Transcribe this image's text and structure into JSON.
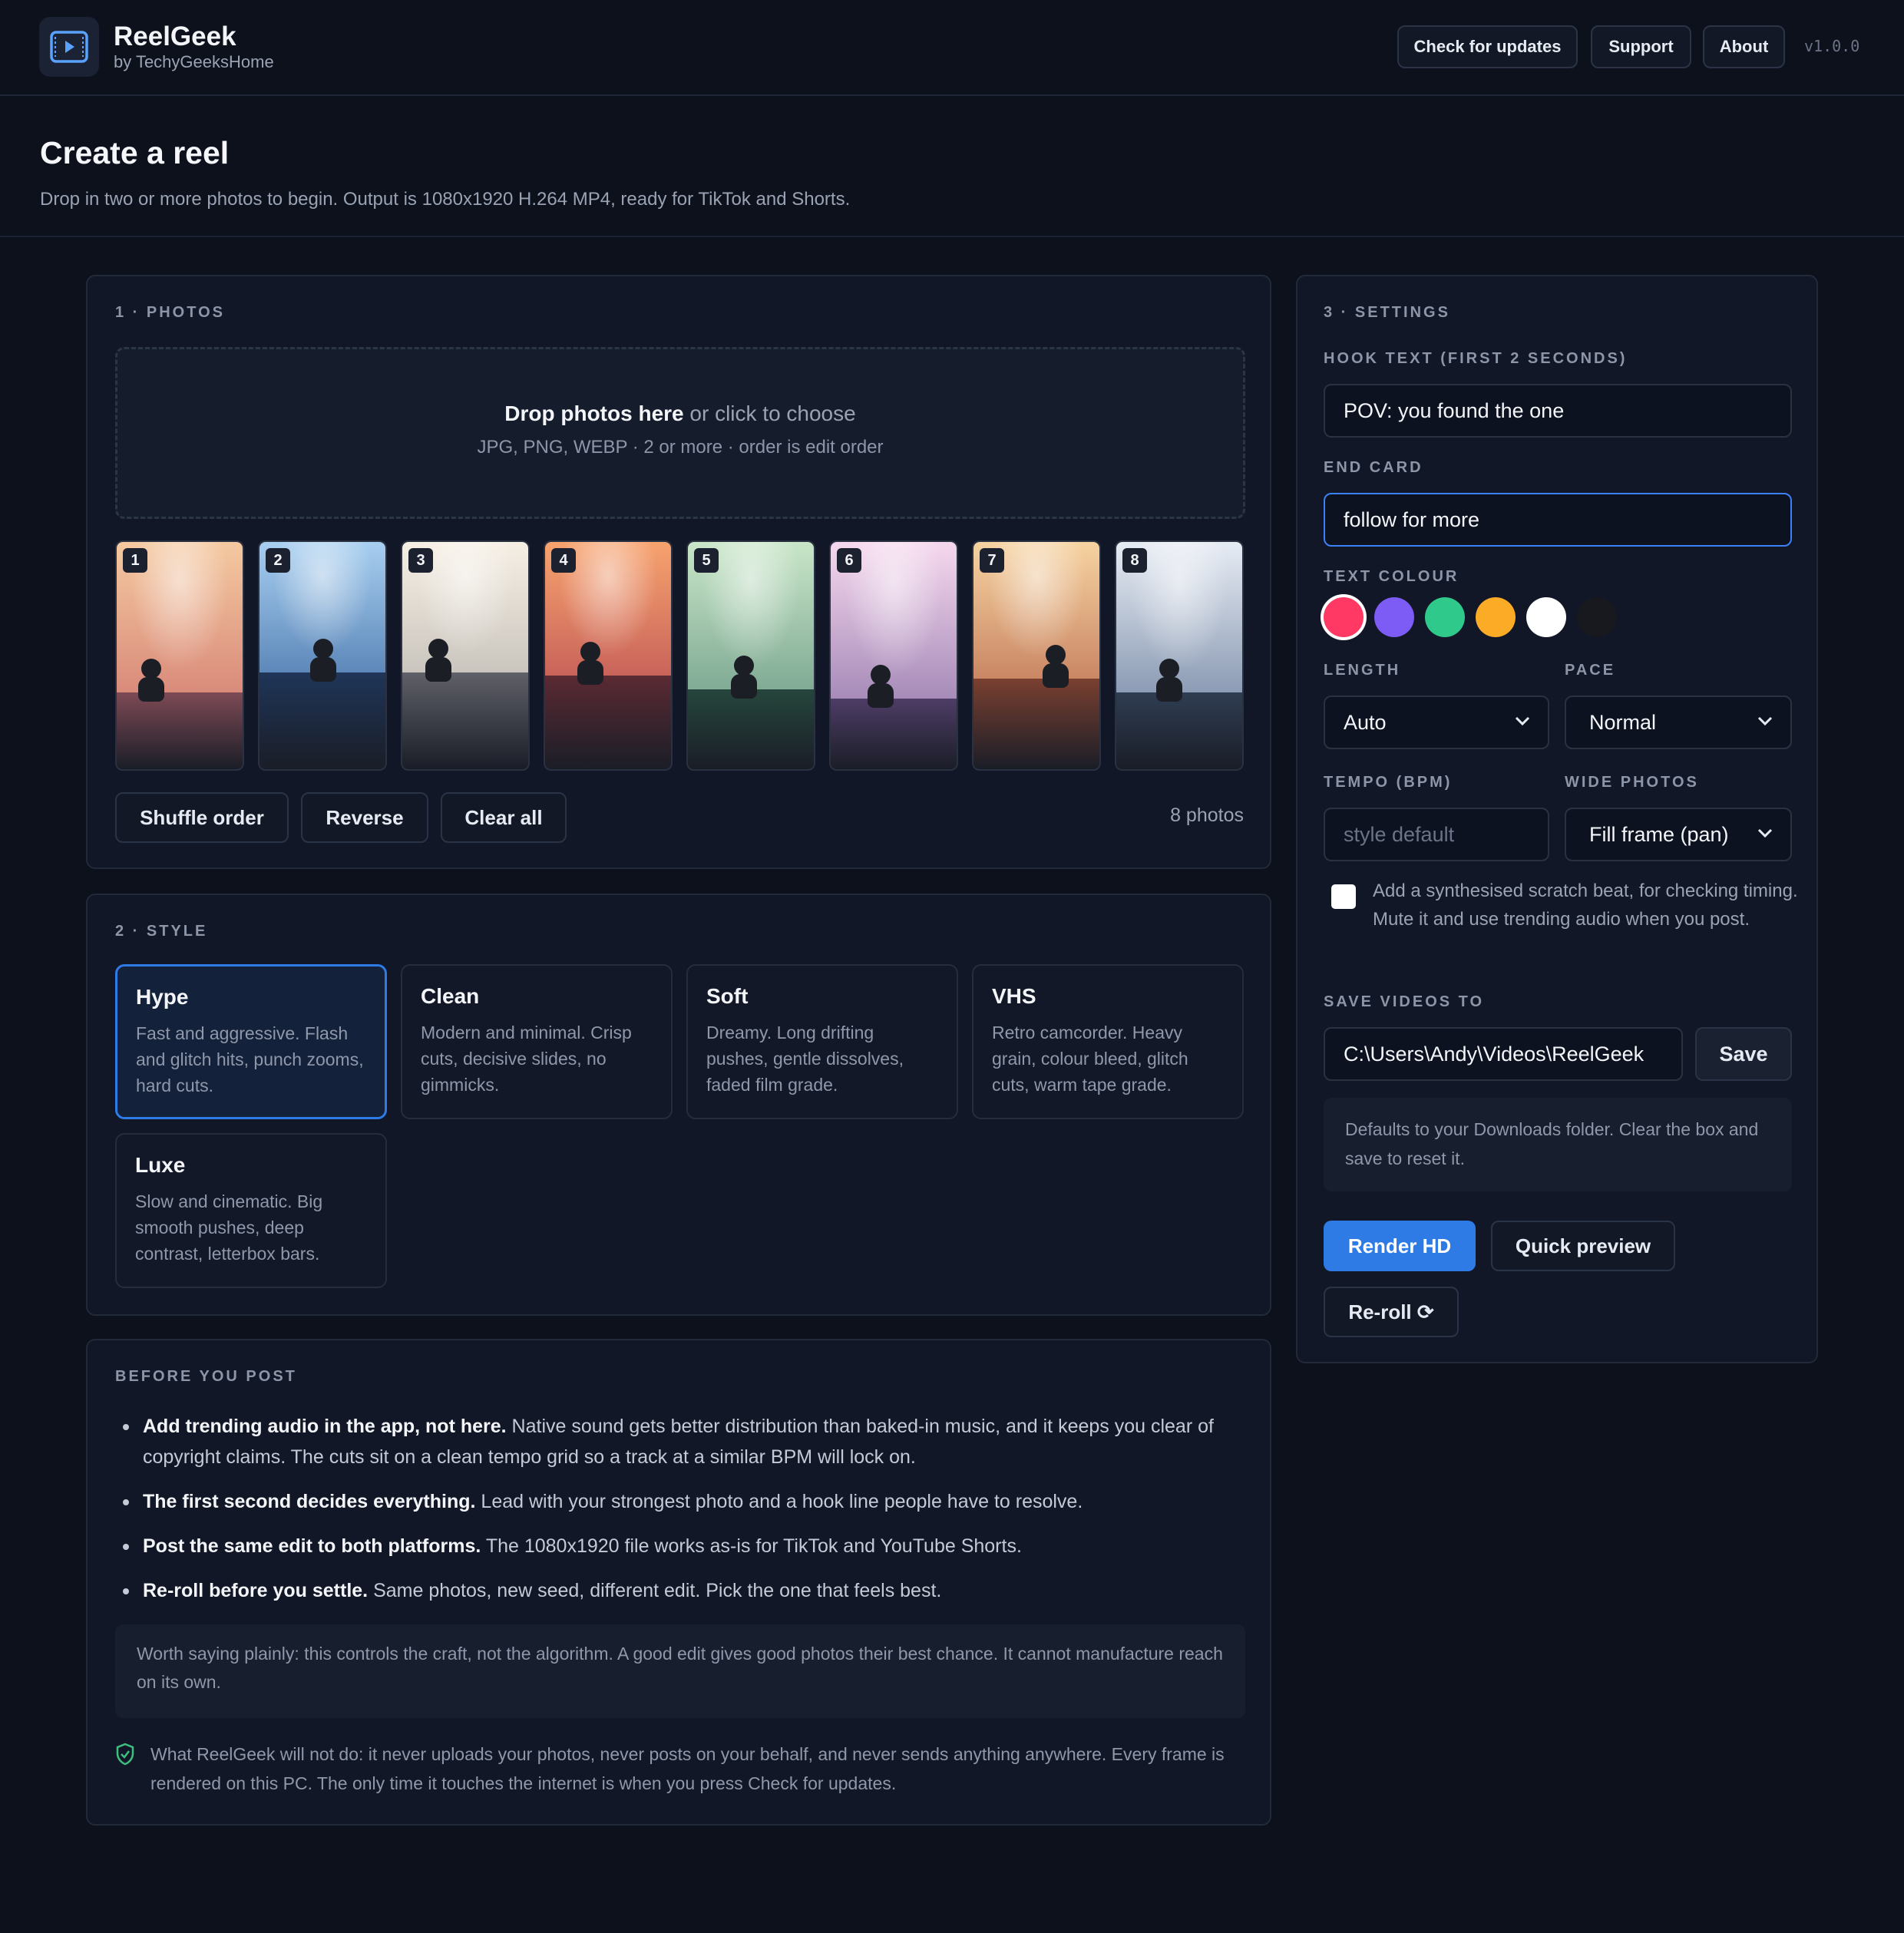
{
  "app": {
    "name": "ReelGeek",
    "byline": "by TechyGeeksHome",
    "version": "v1.0.0",
    "buttons": {
      "check_updates": "Check for updates",
      "support": "Support",
      "about": "About"
    }
  },
  "page": {
    "title": "Create a reel",
    "subtitle": "Drop in two or more photos to begin. Output is 1080x1920 H.264 MP4, ready for TikTok and Shorts."
  },
  "photos": {
    "section_label": "1 · PHOTOS",
    "drop_strong": "Drop photos here",
    "drop_rest": " or click to choose",
    "drop_hint": "JPG, PNG, WEBP · 2 or more · order is edit order",
    "items": [
      {
        "num": "1",
        "sky_top": "#f4c9a0",
        "sky_bottom": "#d98a7a",
        "ground": "#7d4a55"
      },
      {
        "num": "2",
        "sky_top": "#a8cff0",
        "sky_bottom": "#5b86b8",
        "ground": "#1f3558"
      },
      {
        "num": "3",
        "sky_top": "#f6efe4",
        "sky_bottom": "#c9c4bd",
        "ground": "#5f6068"
      },
      {
        "num": "4",
        "sky_top": "#f7a36e",
        "sky_bottom": "#c8625a",
        "ground": "#5b2a33"
      },
      {
        "num": "5",
        "sky_top": "#c9e6c8",
        "sky_bottom": "#7faa94",
        "ground": "#25463c"
      },
      {
        "num": "6",
        "sky_top": "#f6d8ee",
        "sky_bottom": "#a58ab8",
        "ground": "#4e3d66"
      },
      {
        "num": "7",
        "sky_top": "#f6d3a1",
        "sky_bottom": "#c98563",
        "ground": "#7a4030"
      },
      {
        "num": "8",
        "sky_top": "#e7ecf4",
        "sky_bottom": "#8a9ab3",
        "ground": "#2f3d52"
      }
    ],
    "shuffle_label": "Shuffle order",
    "reverse_label": "Reverse",
    "clear_label": "Clear all",
    "count": "8 photos"
  },
  "style": {
    "section_label": "2 · STYLE",
    "selected": "Hype",
    "cards": [
      {
        "name": "Hype",
        "desc": "Fast and aggressive. Flash and glitch hits, punch zooms, hard cuts."
      },
      {
        "name": "Clean",
        "desc": "Modern and minimal. Crisp cuts, decisive slides, no gimmicks."
      },
      {
        "name": "Soft",
        "desc": "Dreamy. Long drifting pushes, gentle dissolves, faded film grade."
      },
      {
        "name": "VHS",
        "desc": "Retro camcorder. Heavy grain, colour bleed, glitch cuts, warm tape grade."
      },
      {
        "name": "Luxe",
        "desc": "Slow and cinematic. Big smooth pushes, deep contrast, letterbox bars."
      }
    ]
  },
  "tips": {
    "section_label": "BEFORE YOU POST",
    "items": [
      {
        "bold": "Add trending audio in the app, not here.",
        "text": " Native sound gets better distribution than baked-in music, and it keeps you clear of copyright claims. The cuts sit on a clean tempo grid so a track at a similar BPM will lock on."
      },
      {
        "bold": "The first second decides everything.",
        "text": " Lead with your strongest photo and a hook line people have to resolve."
      },
      {
        "bold": "Post the same edit to both platforms.",
        "text": " The 1080x1920 file works as-is for TikTok and YouTube Shorts."
      },
      {
        "bold": "Re-roll before you settle.",
        "text": " Same photos, new seed, different edit. Pick the one that feels best."
      }
    ],
    "note": "Worth saying plainly: this controls the craft, not the algorithm. A good edit gives good photos their best chance. It cannot manufacture reach on its own.",
    "privacy": "What ReelGeek will not do: it never uploads your photos, never posts on your behalf, and never sends anything anywhere. Every frame is rendered on this PC. The only time it touches the internet is when you press Check for updates."
  },
  "settings": {
    "section_label": "3 · SETTINGS",
    "hook_label": "HOOK TEXT (FIRST 2 SECONDS)",
    "hook_value": "POV: you found the one",
    "end_card_label": "END CARD",
    "end_card_value": "follow for more",
    "text_colour_label": "TEXT COLOUR",
    "colours": [
      "#ff3864",
      "#7c5cf5",
      "#2fc98b",
      "#fbab26",
      "#ffffff",
      "#17191e"
    ],
    "selected_colour": "#ff3864",
    "length_label": "LENGTH",
    "length_value": "Auto",
    "pace_label": "PACE",
    "pace_value": "Normal",
    "tempo_label": "TEMPO (BPM)",
    "tempo_placeholder": "style default",
    "wide_label": "WIDE PHOTOS",
    "wide_value": "Fill frame (pan)",
    "scratch_beat_checked": false,
    "scratch_beat_text": "Add a synthesised scratch beat, for checking timing. Mute it and use trending audio when you post.",
    "save_to_label": "SAVE VIDEOS TO",
    "save_path": "C:\\Users\\Andy\\Videos\\ReelGeek",
    "save_button": "Save",
    "save_info": "Defaults to your Downloads folder. Clear the box and save to reset it.",
    "render_button": "Render HD",
    "preview_button": "Quick preview",
    "reroll_button": "Re-roll ⟳"
  },
  "colors": {
    "accent": "#2f7be6",
    "background": "#0c111c",
    "panel": "#111726"
  },
  "icons": [
    "play-icon",
    "chevron-down-icon",
    "shield-check-icon",
    "refresh-icon"
  ]
}
